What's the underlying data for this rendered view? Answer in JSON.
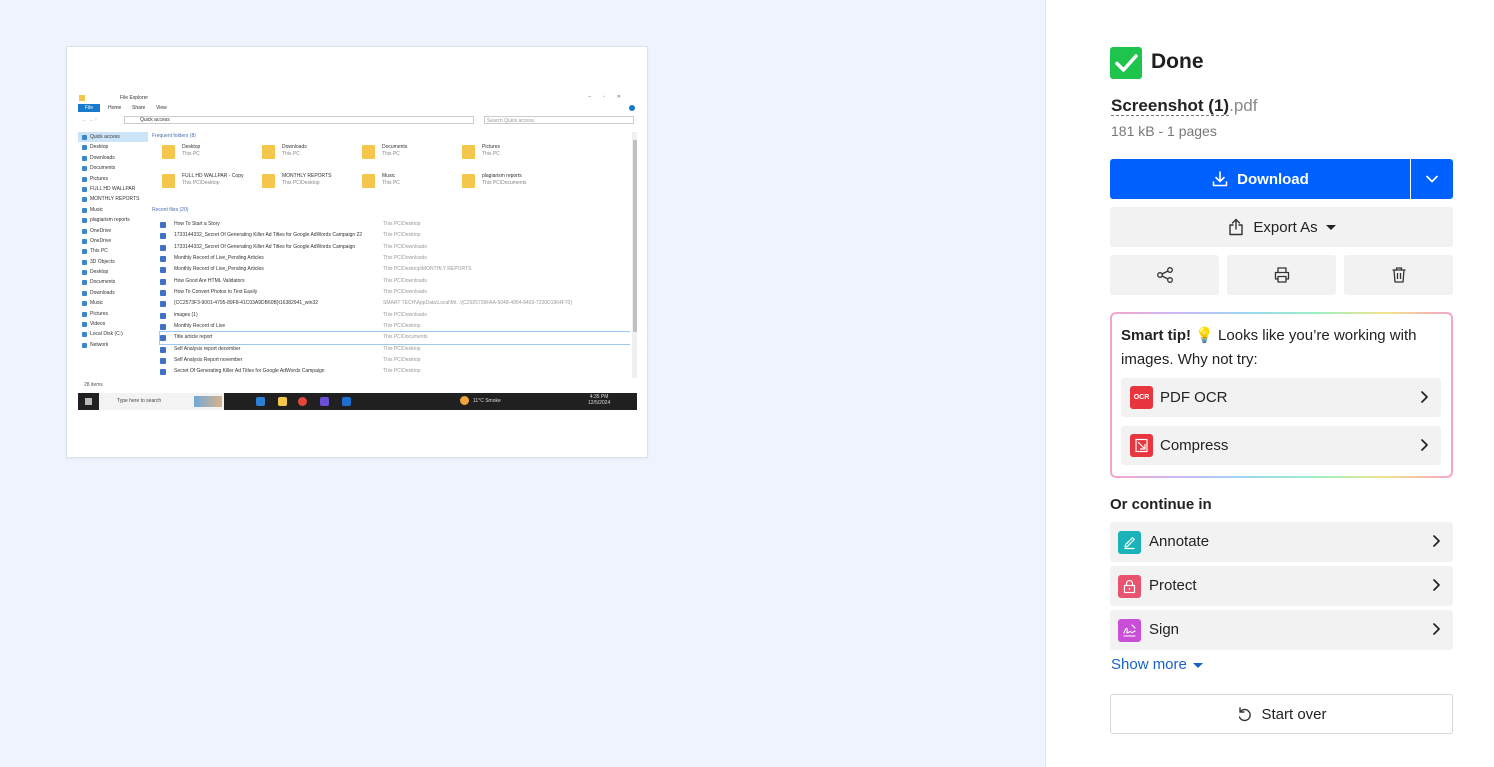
{
  "preview": {
    "explorer": {
      "title": "File Explorer",
      "ribbon": [
        "File",
        "Home",
        "Share",
        "View"
      ],
      "address": "Quick access",
      "search_placeholder": "Search Quick access",
      "nav_items": [
        "Quick access",
        "Desktop",
        "Downloads",
        "Documents",
        "Pictures",
        "FULL HD WALLPAR",
        "MONTHLY REPORTS",
        "Music",
        "plagiarism reports",
        "OneDrive",
        "OneDrive",
        "This PC",
        "3D Objects",
        "Desktop",
        "Documents",
        "Downloads",
        "Music",
        "Pictures",
        "Videos",
        "Local Disk (C:)",
        "Network"
      ],
      "frequent_header": "Frequent folders (8)",
      "folders": [
        {
          "name": "Desktop",
          "path": "This PC"
        },
        {
          "name": "Downloads",
          "path": "This PC"
        },
        {
          "name": "Documents",
          "path": "This PC"
        },
        {
          "name": "Pictures",
          "path": "This PC"
        },
        {
          "name": "FULL HD WALLPAR - Copy",
          "path": "This PC\\Desktop"
        },
        {
          "name": "MONTHLY REPORTS",
          "path": "This PC\\Desktop"
        },
        {
          "name": "Music",
          "path": "This PC"
        },
        {
          "name": "plagiarism reports",
          "path": "This PC\\Documents"
        }
      ],
      "recent_header": "Recent files (20)",
      "files": [
        {
          "name": "How To Start a Story",
          "location": "This PC\\Desktop"
        },
        {
          "name": "1733144332_Secret Of Generating Killer Ad Titles for Google AdWords Campaign 22",
          "location": "This PC\\Desktop"
        },
        {
          "name": "1733144332_Secret Of Generating Killer Ad Titles for Google AdWords Campaign",
          "location": "This PC\\Downloads"
        },
        {
          "name": "Monthly Record of Live_Pending Articles",
          "location": "This PC\\Downloads"
        },
        {
          "name": "Monthly Record of Live_Pending Articles",
          "location": "This PC\\Desktop\\MONTHLY REPORTS"
        },
        {
          "name": "How Good Are HTML Validators",
          "location": "This PC\\Downloads"
        },
        {
          "name": "How To Convert Photos to Text Easily",
          "location": "This PC\\Downloads"
        },
        {
          "name": "{CC2573F3-9001-4795-89F8-41C03A9DB60B}t16382941_win32",
          "location": "SMART TECH\\AppData\\Local\\Mi...\\{C2925739FAA-5048-4954-8403-7230D1964F70}"
        },
        {
          "name": "images (1)",
          "location": "This PC\\Downloads"
        },
        {
          "name": "Monthly Record of Live",
          "location": "This PC\\Desktop"
        },
        {
          "name": "Title article report",
          "location": "This PC\\Documents"
        },
        {
          "name": "Self Analysis report december",
          "location": "This PC\\Desktop"
        },
        {
          "name": "Self Analysis Report november",
          "location": "This PC\\Desktop"
        },
        {
          "name": "Secret Of Generating Killer Ad Titles for Google AdWords Campaign",
          "location": "This PC\\Desktop"
        }
      ],
      "status": "28 items",
      "taskbar_search": "Type here to search",
      "weather": "11°C Smoke",
      "time": "4:35 PM",
      "date": "12/5/2024"
    }
  },
  "panel": {
    "done_label": "Done",
    "file_name": "Screenshot (1)",
    "file_ext": ".pdf",
    "file_meta": "181 kB - 1 pages",
    "download_label": "Download",
    "export_label": "Export As",
    "smart_tip_bold": "Smart tip!",
    "smart_tip_text": "Looks like you’re working with images. Why not try:",
    "tip_options": [
      {
        "label": "PDF OCR",
        "badge": "OCR"
      },
      {
        "label": "Compress"
      }
    ],
    "continue_label": "Or continue in",
    "continue_items": [
      {
        "label": "Annotate",
        "color": "#19b3b9"
      },
      {
        "label": "Protect",
        "color": "#e8536d"
      },
      {
        "label": "Sign",
        "color": "#c94fd6"
      }
    ],
    "show_more": "Show more",
    "start_over": "Start over",
    "colors": {
      "primary": "#0061fe",
      "done": "#1fc44c"
    }
  }
}
